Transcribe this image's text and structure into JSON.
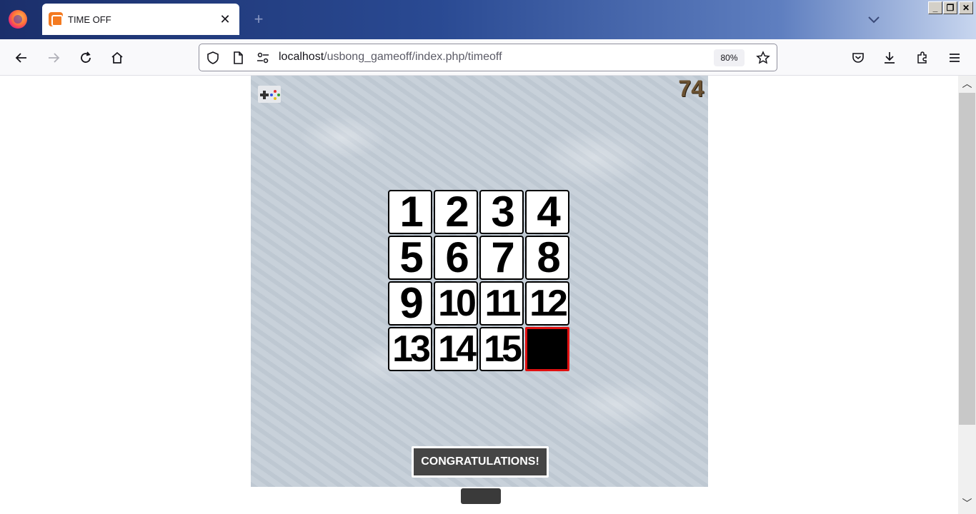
{
  "browser": {
    "tab": {
      "title": "TIME OFF"
    },
    "new_tab_symbol": "+",
    "close_symbol": "✕",
    "window_buttons": {
      "minimize": "_",
      "restore": "❐",
      "close": "✕"
    },
    "url": {
      "host": "localhost",
      "path": "/usbong_gameoff/index.php/timeoff"
    },
    "zoom": "80%"
  },
  "game": {
    "score": "74",
    "tiles": [
      "1",
      "2",
      "3",
      "4",
      "5",
      "6",
      "7",
      "8",
      "9",
      "10",
      "11",
      "12",
      "13",
      "14",
      "15",
      ""
    ],
    "empty_tile_border_color": "#e01010",
    "congrats_label": "CONGRATULATIONS!",
    "controller_colors": [
      "#e03030",
      "#30a030",
      "#3050e0",
      "#e0c020"
    ]
  },
  "scrollbar": {
    "up_arrow": "︿",
    "down_arrow": "﹀"
  }
}
